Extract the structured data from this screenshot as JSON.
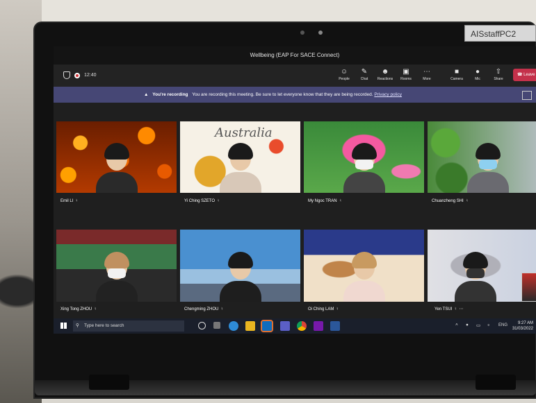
{
  "sticker": {
    "text": "AISstaffPC2"
  },
  "window": {
    "title": "Wellbeing (EAP For SACE Connect)"
  },
  "toolbar": {
    "timer": "12:40",
    "buttons": [
      {
        "label": "People",
        "icon": "people-icon"
      },
      {
        "label": "Chat",
        "icon": "chat-icon"
      },
      {
        "label": "Reactions",
        "icon": "reactions-icon"
      },
      {
        "label": "Rooms",
        "icon": "rooms-icon"
      },
      {
        "label": "More",
        "icon": "more-icon"
      },
      {
        "label": "Camera",
        "icon": "camera-icon"
      },
      {
        "label": "Mic",
        "icon": "mic-icon"
      },
      {
        "label": "Share",
        "icon": "share-icon"
      }
    ],
    "leave_label": "Leave"
  },
  "banner": {
    "title": "You're recording",
    "message": "You are recording this meeting. Be sure to let everyone know that they are being recorded.",
    "link": "Privacy policy"
  },
  "participants": [
    {
      "name": "Emil LI"
    },
    {
      "name": "Yi Ching SZETO"
    },
    {
      "name": "My Ngoc TRAN"
    },
    {
      "name": "Chuanzheng SHI"
    },
    {
      "name": "Xing Tong ZHOU"
    },
    {
      "name": "Chengming ZHOU"
    },
    {
      "name": "Oi Ching LAM"
    },
    {
      "name": "Yen TSUI"
    }
  ],
  "backgrounds": {
    "australia_text": "Australia"
  },
  "taskbar": {
    "search_placeholder": "Type here to search",
    "lang": "ENG",
    "time": "9:27 AM",
    "date": "31/03/2022"
  },
  "colors": {
    "banner": "#464775",
    "leave": "#c4314b",
    "screen_bg": "#1f1f1f"
  }
}
